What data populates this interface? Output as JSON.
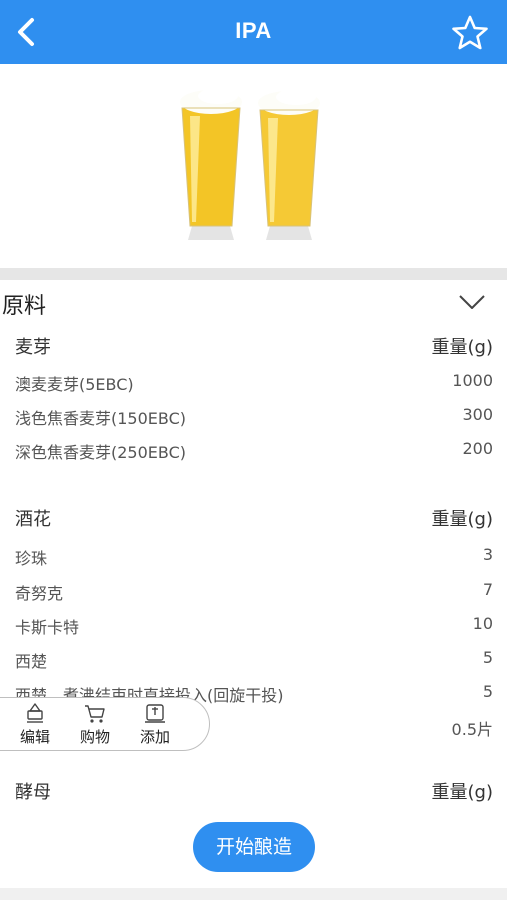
{
  "header": {
    "title": "IPA",
    "back_icon": "chevron-left-icon",
    "favorite_icon": "star-outline-icon",
    "bar_color": "#2f8ff0"
  },
  "hero": {
    "image": "two-beer-glasses"
  },
  "ingredients": {
    "section_label": "原料",
    "collapse_icon": "chevron-down-icon",
    "malt": {
      "title": "麦芽",
      "weight_header": "重量(g)",
      "items": [
        {
          "name": "澳麦麦芽(5EBC)",
          "value": "1000"
        },
        {
          "name": "浅色焦香麦芽(150EBC)",
          "value": "300"
        },
        {
          "name": "深色焦香麦芽(250EBC)",
          "value": "200"
        }
      ]
    },
    "hops": {
      "title": "酒花",
      "weight_header": "重量(g)",
      "items": [
        {
          "name": "珍珠",
          "value": "3"
        },
        {
          "name": "奇努克",
          "value": "7"
        },
        {
          "name": "卡斯卡特",
          "value": "10"
        },
        {
          "name": "西楚",
          "value": "5"
        },
        {
          "name": "西楚，煮沸结束时直接投入(回旋干投)",
          "value": "5"
        },
        {
          "name": "",
          "value": "0.5片"
        }
      ]
    },
    "yeast": {
      "title": "酵母",
      "weight_header": "重量(g)"
    }
  },
  "toolbar": {
    "edit_label": "编辑",
    "shop_label": "购物",
    "add_label": "添加"
  },
  "action": {
    "start_label": "开始酿造",
    "color": "#2f8ff0"
  }
}
